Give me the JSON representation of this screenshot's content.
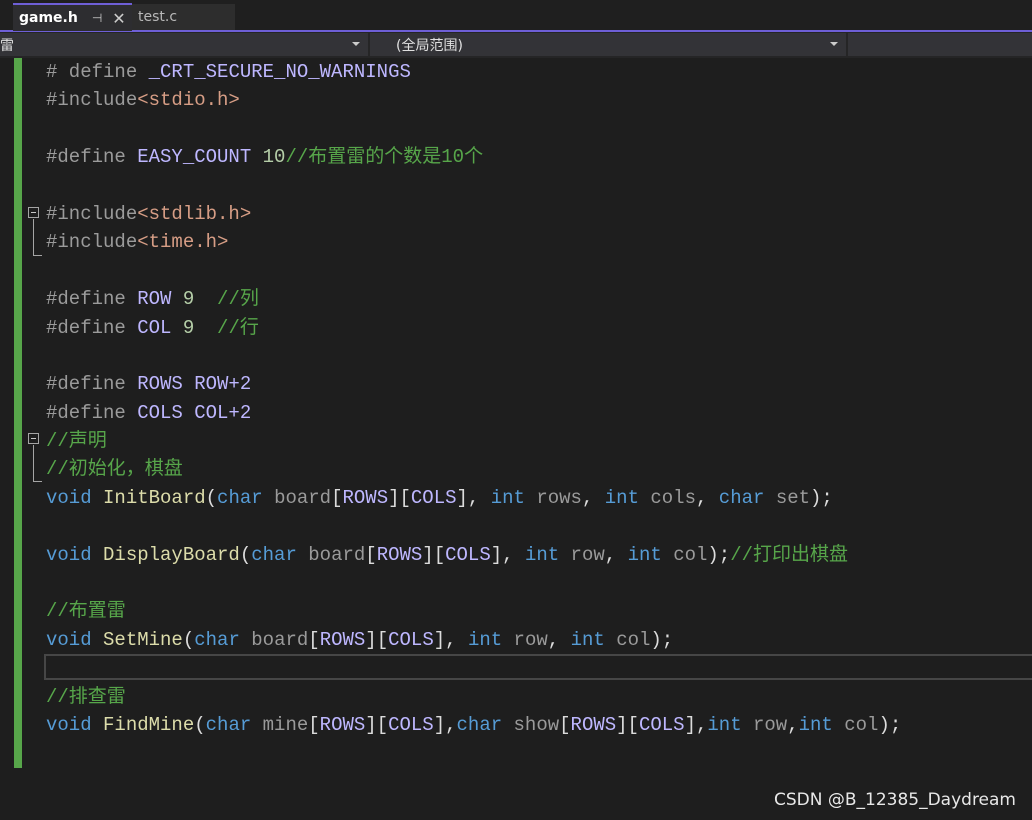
{
  "tabs": [
    {
      "label": "game.h",
      "active": true
    },
    {
      "label": "test.c",
      "active": false
    }
  ],
  "navbar": {
    "project": "雷",
    "scope": "(全局范围)"
  },
  "code_lines": [
    [
      [
        "# define ",
        "dir"
      ],
      [
        "_CRT_SECURE_NO_WARNINGS",
        "mac"
      ]
    ],
    [
      [
        "#include",
        "dir"
      ],
      [
        "<stdio.h>",
        "str"
      ]
    ],
    [],
    [
      [
        "#define ",
        "dir"
      ],
      [
        "EASY_COUNT",
        "mac"
      ],
      [
        " 10",
        "num"
      ],
      [
        "//布置雷的个数是10个",
        "cm"
      ]
    ],
    [],
    [
      [
        "#include",
        "dir"
      ],
      [
        "<stdlib.h>",
        "str"
      ]
    ],
    [
      [
        "#include",
        "dir"
      ],
      [
        "<time.h>",
        "str"
      ]
    ],
    [],
    [
      [
        "#define ",
        "dir"
      ],
      [
        "ROW",
        "mac"
      ],
      [
        " 9  ",
        "num"
      ],
      [
        "//列",
        "cm"
      ]
    ],
    [
      [
        "#define ",
        "dir"
      ],
      [
        "COL",
        "mac"
      ],
      [
        " 9  ",
        "num"
      ],
      [
        "//行",
        "cm"
      ]
    ],
    [],
    [
      [
        "#define ",
        "dir"
      ],
      [
        "ROWS",
        "mac"
      ],
      [
        " ROW+2",
        "mac"
      ]
    ],
    [
      [
        "#define ",
        "dir"
      ],
      [
        "COLS",
        "mac"
      ],
      [
        " COL+2",
        "mac"
      ]
    ],
    [
      [
        "//声明",
        "cm"
      ]
    ],
    [
      [
        "//初始化，棋盘",
        "cm"
      ]
    ],
    [
      [
        "void ",
        "kw"
      ],
      [
        "InitBoard",
        "fn"
      ],
      [
        "(",
        "pl"
      ],
      [
        "char ",
        "kw"
      ],
      [
        "board",
        "par"
      ],
      [
        "[",
        "pl"
      ],
      [
        "ROWS",
        "mac"
      ],
      [
        "][",
        "pl"
      ],
      [
        "COLS",
        "mac"
      ],
      [
        "], ",
        "pl"
      ],
      [
        "int ",
        "kw"
      ],
      [
        "rows",
        "par"
      ],
      [
        ", ",
        "pl"
      ],
      [
        "int ",
        "kw"
      ],
      [
        "cols",
        "par"
      ],
      [
        ", ",
        "pl"
      ],
      [
        "char ",
        "kw"
      ],
      [
        "set",
        "par"
      ],
      [
        ");",
        "pl"
      ]
    ],
    [],
    [
      [
        "void ",
        "kw"
      ],
      [
        "DisplayBoard",
        "fn"
      ],
      [
        "(",
        "pl"
      ],
      [
        "char ",
        "kw"
      ],
      [
        "board",
        "par"
      ],
      [
        "[",
        "pl"
      ],
      [
        "ROWS",
        "mac"
      ],
      [
        "][",
        "pl"
      ],
      [
        "COLS",
        "mac"
      ],
      [
        "], ",
        "pl"
      ],
      [
        "int ",
        "kw"
      ],
      [
        "row",
        "par"
      ],
      [
        ", ",
        "pl"
      ],
      [
        "int ",
        "kw"
      ],
      [
        "col",
        "par"
      ],
      [
        ");",
        "pl"
      ],
      [
        "//打印出棋盘",
        "cm"
      ]
    ],
    [],
    [
      [
        "//布置雷",
        "cm"
      ]
    ],
    [
      [
        "void ",
        "kw"
      ],
      [
        "SetMine",
        "fn"
      ],
      [
        "(",
        "pl"
      ],
      [
        "char ",
        "kw"
      ],
      [
        "board",
        "par"
      ],
      [
        "[",
        "pl"
      ],
      [
        "ROWS",
        "mac"
      ],
      [
        "][",
        "pl"
      ],
      [
        "COLS",
        "mac"
      ],
      [
        "], ",
        "pl"
      ],
      [
        "int ",
        "kw"
      ],
      [
        "row",
        "par"
      ],
      [
        ", ",
        "pl"
      ],
      [
        "int ",
        "kw"
      ],
      [
        "col",
        "par"
      ],
      [
        ");",
        "pl"
      ]
    ],
    [],
    [
      [
        "//排查雷",
        "cm"
      ]
    ],
    [
      [
        "void ",
        "kw"
      ],
      [
        "FindMine",
        "fn"
      ],
      [
        "(",
        "pl"
      ],
      [
        "char ",
        "kw"
      ],
      [
        "mine",
        "par"
      ],
      [
        "[",
        "pl"
      ],
      [
        "ROWS",
        "mac"
      ],
      [
        "][",
        "pl"
      ],
      [
        "COLS",
        "mac"
      ],
      [
        "],",
        "pl"
      ],
      [
        "char ",
        "kw"
      ],
      [
        "show",
        "par"
      ],
      [
        "[",
        "pl"
      ],
      [
        "ROWS",
        "mac"
      ],
      [
        "][",
        "pl"
      ],
      [
        "COLS",
        "mac"
      ],
      [
        "],",
        "pl"
      ],
      [
        "int ",
        "kw"
      ],
      [
        "row",
        "par"
      ],
      [
        ",",
        "pl"
      ],
      [
        "int ",
        "kw"
      ],
      [
        "col",
        "par"
      ],
      [
        ");",
        "pl"
      ]
    ]
  ],
  "colors": {
    "accent": "#6e5fd6",
    "change_bar": "#57a64a",
    "keyword": "#569cd6",
    "function": "#dcdcaa",
    "macro": "#beb7ff",
    "comment": "#57a64a",
    "string": "#d69d85"
  },
  "watermark": "CSDN @B_12385_Daydream"
}
